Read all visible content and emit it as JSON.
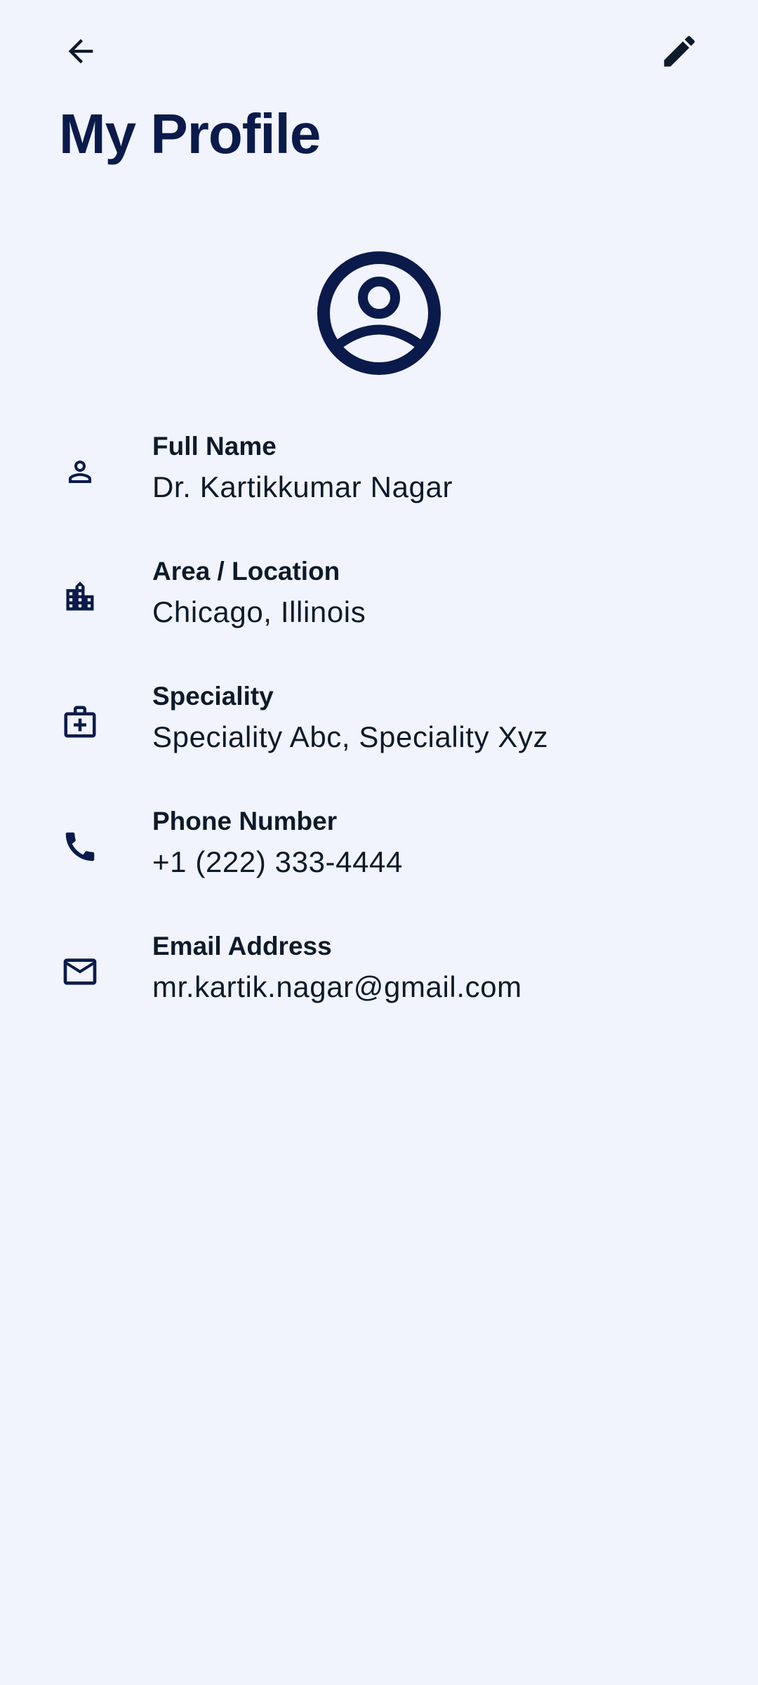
{
  "header": {
    "title": "My Profile",
    "back_icon": "arrow-back-icon",
    "edit_icon": "pencil-edit-icon"
  },
  "avatar": {
    "icon": "account-circle-icon"
  },
  "profile": {
    "items": [
      {
        "icon": "person-icon",
        "label": "Full Name",
        "value": "Dr. Kartikkumar Nagar"
      },
      {
        "icon": "city-buildings-icon",
        "label": "Area / Location",
        "value": "Chicago, Illinois"
      },
      {
        "icon": "medical-bag-icon",
        "label": "Speciality",
        "value": "Speciality Abc, Speciality Xyz"
      },
      {
        "icon": "phone-icon",
        "label": "Phone Number",
        "value": "+1 (222) 333-4444"
      },
      {
        "icon": "mail-icon",
        "label": "Email Address",
        "value": "mr.kartik.nagar@gmail.com"
      }
    ]
  },
  "colors": {
    "background": "#f1f4fc",
    "title": "#0a1a4a",
    "icon": "#0a1a4a",
    "text": "#0d1a2b"
  }
}
